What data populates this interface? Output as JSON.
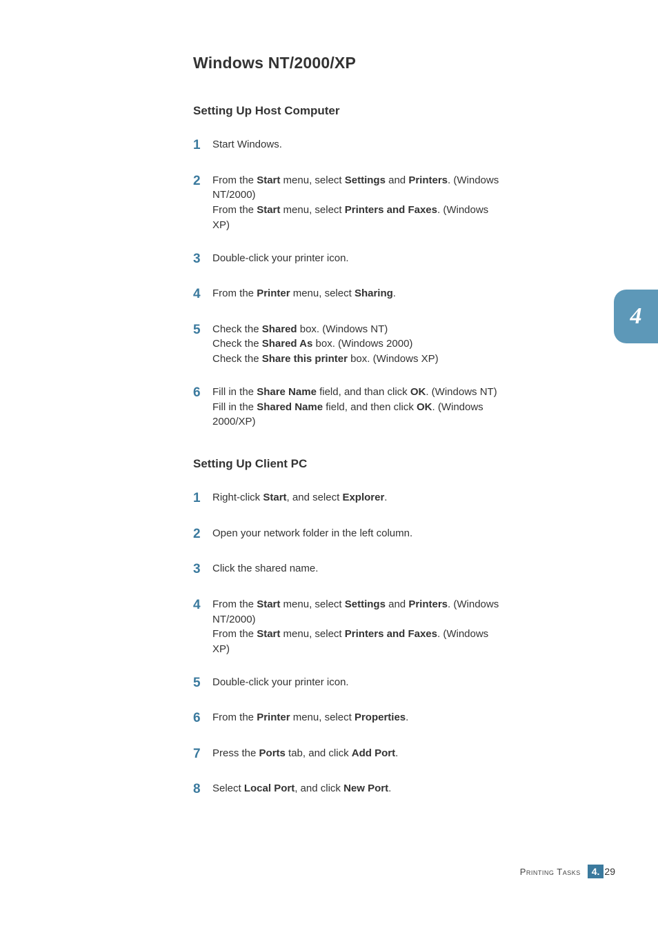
{
  "title": "Windows NT/2000/XP",
  "sideTab": "4",
  "footer": {
    "label": "Printing Tasks",
    "chapter": "4.",
    "page": "29"
  },
  "sections": [
    {
      "heading": "Setting Up Host Computer",
      "steps": [
        {
          "n": "1",
          "html": "Start Windows."
        },
        {
          "n": "2",
          "html": "From the <b>Start</b> menu, select <b>Settings</b> and <b>Printers</b>. (Windows NT/2000)<br>From the <b>Start</b> menu, select <b>Printers and Faxes</b>. (Windows XP)"
        },
        {
          "n": "3",
          "html": "Double-click your printer icon."
        },
        {
          "n": "4",
          "html": "From the <b>Printer</b> menu, select <b>Sharing</b>."
        },
        {
          "n": "5",
          "html": "Check the <b>Shared</b> box. (Windows NT)<br>Check the <b>Shared As</b> box. (Windows 2000)<br>Check the <b>Share this printer</b> box. (Windows XP)"
        },
        {
          "n": "6",
          "html": "Fill in the <b>Share Name</b> field, and than click <b>OK</b>. (Windows NT)<br>Fill in the <b>Shared Name</b> field, and then click <b>OK</b>. (Windows 2000/XP)"
        }
      ]
    },
    {
      "heading": "Setting Up Client PC",
      "steps": [
        {
          "n": "1",
          "html": "Right-click <b>Start</b>, and select <b>Explorer</b>."
        },
        {
          "n": "2",
          "html": "Open your network folder in the left column."
        },
        {
          "n": "3",
          "html": "Click the shared name."
        },
        {
          "n": "4",
          "html": "From the <b>Start</b> menu, select <b>Settings</b> and <b>Printers</b>. (Windows NT/2000)<br>From the <b>Start</b> menu, select <b>Printers and Faxes</b>. (Windows XP)"
        },
        {
          "n": "5",
          "html": "Double-click your printer icon."
        },
        {
          "n": "6",
          "html": "From the <b>Printer</b> menu, select <b>Properties</b>."
        },
        {
          "n": "7",
          "html": "Press the <b>Ports</b> tab, and click <b>Add Port</b>."
        },
        {
          "n": "8",
          "html": "Select <b>Local Port</b>, and click <b>New Port</b>."
        }
      ]
    }
  ]
}
